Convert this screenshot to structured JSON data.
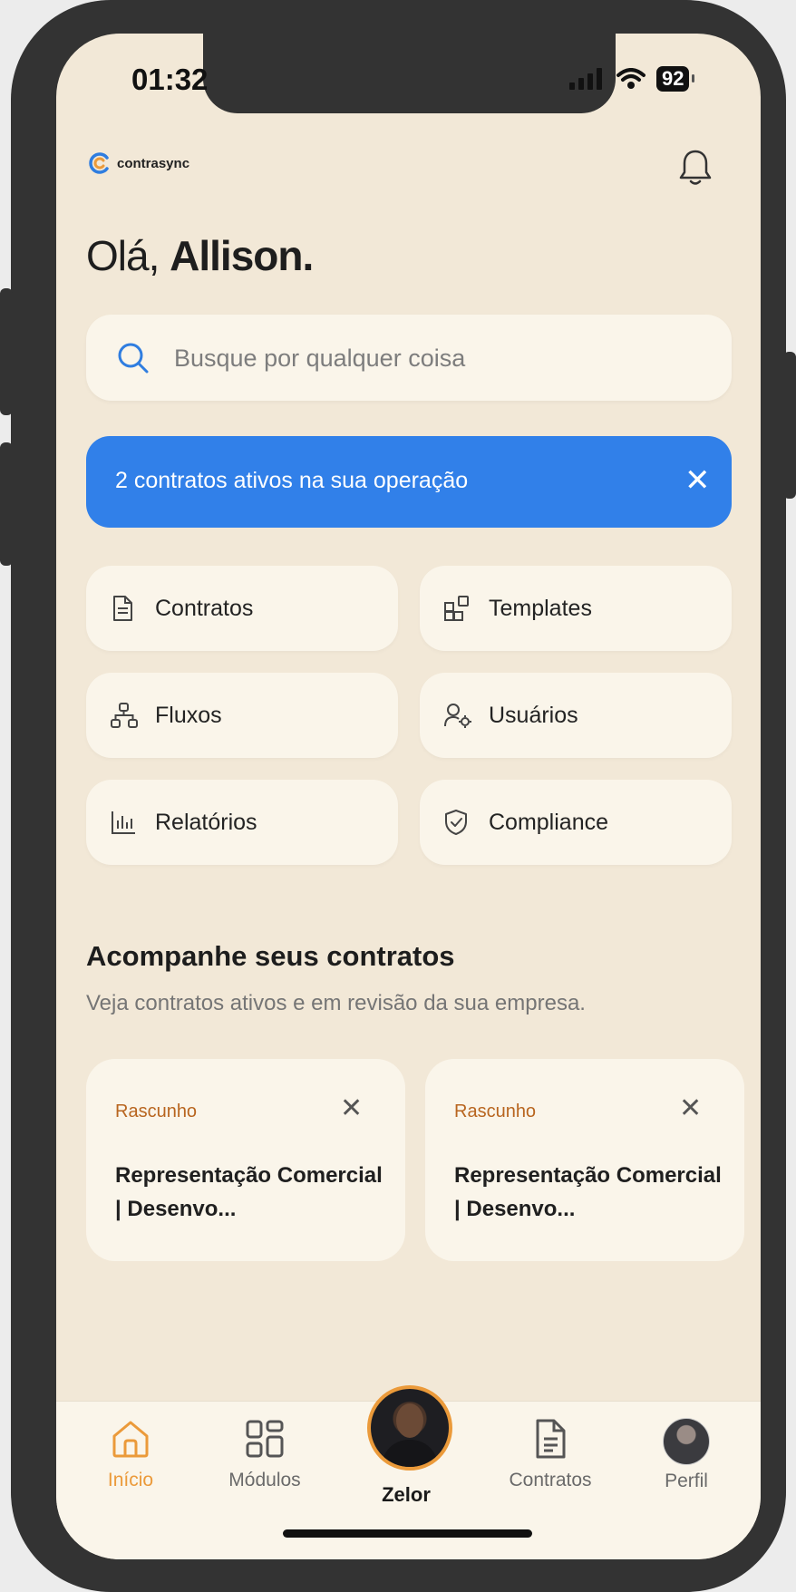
{
  "status_bar": {
    "time": "01:32",
    "battery": "92"
  },
  "brand": {
    "name": "contrasync"
  },
  "greeting": {
    "prefix": "Olá, ",
    "name": "Allison."
  },
  "search": {
    "placeholder": "Busque por qualquer coisa"
  },
  "banner": {
    "text": "2 contratos ativos na sua operação"
  },
  "modules": [
    {
      "label": "Contratos",
      "icon": "document-icon"
    },
    {
      "label": "Templates",
      "icon": "templates-icon"
    },
    {
      "label": "Fluxos",
      "icon": "flow-icon"
    },
    {
      "label": "Usuários",
      "icon": "user-settings-icon"
    },
    {
      "label": "Relatórios",
      "icon": "chart-icon"
    },
    {
      "label": "Compliance",
      "icon": "shield-check-icon"
    }
  ],
  "section": {
    "title": "Acompanhe seus contratos",
    "subtitle": "Veja contratos ativos e em revisão da sua empresa."
  },
  "contracts": [
    {
      "status": "Rascunho",
      "title": "Representação Comercial | Desenvo..."
    },
    {
      "status": "Rascunho",
      "title": "Representação Comercial | Desenvo..."
    }
  ],
  "tabbar": {
    "items": [
      {
        "label": "Início",
        "icon": "home-icon",
        "active": true
      },
      {
        "label": "Módulos",
        "icon": "grid-icon",
        "active": false
      },
      {
        "label": "Zelor",
        "icon": "assistant-avatar",
        "active": false
      },
      {
        "label": "Contratos",
        "icon": "document-icon",
        "active": false
      },
      {
        "label": "Perfil",
        "icon": "profile-avatar",
        "active": false
      }
    ]
  },
  "colors": {
    "background": "#f2e8d7",
    "card": "#faf5ea",
    "accent_blue": "#3180e9",
    "accent_orange": "#eb9a3a",
    "status_draft": "#b8651f"
  }
}
